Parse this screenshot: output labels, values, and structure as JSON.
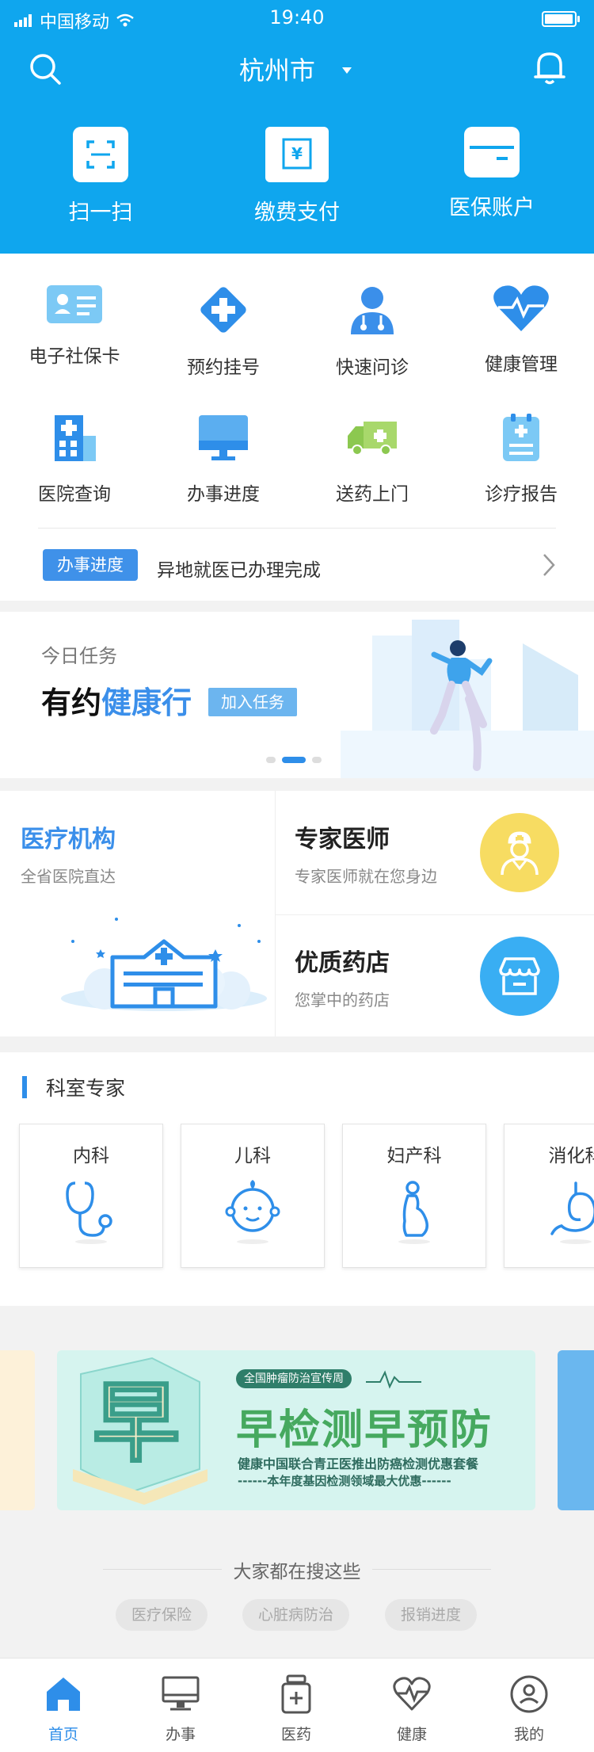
{
  "status_bar": {
    "carrier": "中国移动",
    "time": "19:40"
  },
  "header": {
    "city": "杭州市",
    "quick_actions": [
      {
        "label": "扫一扫",
        "icon": "scan-icon"
      },
      {
        "label": "缴费支付",
        "icon": "payment-icon"
      },
      {
        "label": "医保账户",
        "icon": "card-icon"
      }
    ]
  },
  "grid": {
    "items": [
      {
        "label": "电子社保卡",
        "icon": "id-card-icon"
      },
      {
        "label": "预约挂号",
        "icon": "cross-icon"
      },
      {
        "label": "快速问诊",
        "icon": "doctor-icon"
      },
      {
        "label": "健康管理",
        "icon": "heart-icon"
      },
      {
        "label": "医院查询",
        "icon": "hospital-building-icon"
      },
      {
        "label": "办事进度",
        "icon": "monitor-icon"
      },
      {
        "label": "送药上门",
        "icon": "truck-icon"
      },
      {
        "label": "诊疗报告",
        "icon": "report-icon"
      }
    ],
    "notice_tag": "办事进度",
    "notice_text": "异地就医已办理完成"
  },
  "task": {
    "subtitle": "今日任务",
    "title_part1": "有约",
    "title_part2": "健康行",
    "button": "加入任务"
  },
  "services": {
    "main": {
      "title": "医疗机构",
      "subtitle": "全省医院直达"
    },
    "expert": {
      "title": "专家医师",
      "subtitle": "专家医师就在您身边"
    },
    "pharmacy": {
      "title": "优质药店",
      "subtitle": "您掌中的药店"
    }
  },
  "dept": {
    "title": "科室专家",
    "items": [
      {
        "label": "内科"
      },
      {
        "label": "儿科"
      },
      {
        "label": "妇产科"
      },
      {
        "label": "消化科"
      }
    ]
  },
  "banner": {
    "pill": "全国肿瘤防治宣传周",
    "headline": "早检测早预防",
    "line1": "健康中国联合青正医推出防癌检测优惠套餐",
    "line2": "------本年度基因检测领域最大优惠------",
    "glyph": "早"
  },
  "hot": {
    "title": "大家都在搜这些",
    "chips": [
      "医疗保险",
      "心脏病防治",
      "报销进度"
    ]
  },
  "tabbar": {
    "items": [
      {
        "label": "首页"
      },
      {
        "label": "办事"
      },
      {
        "label": "医药"
      },
      {
        "label": "健康"
      },
      {
        "label": "我的"
      }
    ]
  },
  "colors": {
    "header": "#0fa6ee",
    "accent": "#2e8ee9",
    "tag": "#3f91e9"
  }
}
